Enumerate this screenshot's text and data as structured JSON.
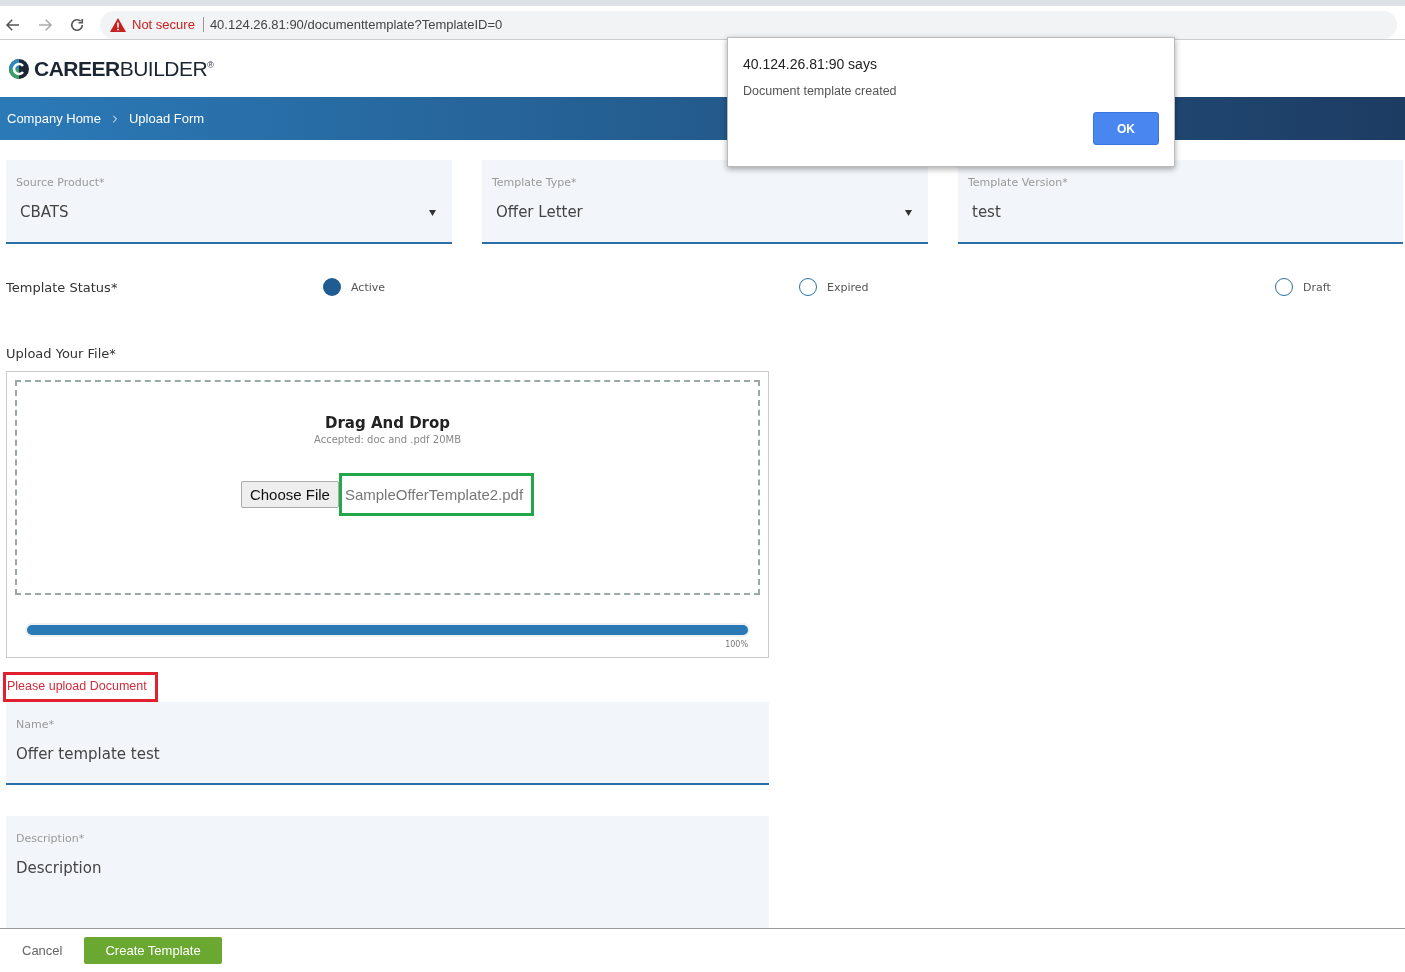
{
  "browser": {
    "security": "Not secure",
    "url": "40.124.26.81:90/documenttemplate?TemplateID=0"
  },
  "logo": "**CAREER**BUILDER$^{®}$",
  "breadcrumb": [
    {
      "label": "Company Home"
    },
    {
      "label": "Upload Form"
    }
  ],
  "selects": [
    {
      "label": "Source Product*",
      "value": "CBATS",
      "kind": "dropdown"
    },
    {
      "label": "Template Type*",
      "value": "Offer Letter",
      "kind": "dropdown"
    },
    {
      "label": "Template Version*",
      "value": "test",
      "kind": "text"
    }
  ],
  "template_status": {
    "label": "Template Status*",
    "options": [
      {
        "label": "Active",
        "selected": true
      },
      {
        "label": "Expired",
        "selected": false
      },
      {
        "label": "Draft",
        "selected": false
      }
    ]
  },
  "upload": {
    "label": "Upload Your File*",
    "title": "Drag And Drop",
    "hint": "Accepted: doc and .pdf 20MB",
    "button": "Choose File",
    "file_name": "SampleOfferTemplate2.pdf",
    "level": 1,
    "percent": "100%"
  },
  "error": "Please upload Document",
  "name_field": {
    "label": "Name*",
    "value": "Offer template test"
  },
  "description_field": {
    "label": "Description*",
    "placeholder": "Description"
  },
  "footer": {
    "cancel": "Cancel",
    "submit": "Create Template"
  },
  "dialog": {
    "title": "40.124.26.81:90 says",
    "message": "Document template created",
    "button": "OK"
  }
}
